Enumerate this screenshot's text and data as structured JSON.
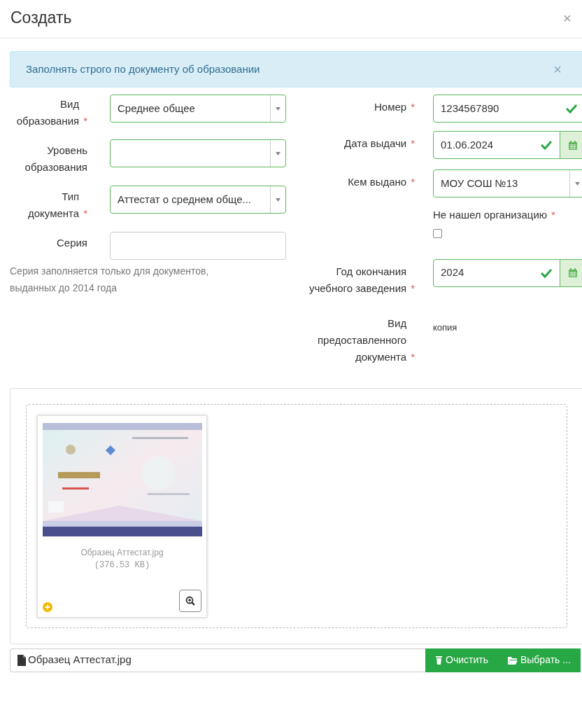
{
  "modal": {
    "title": "Создать",
    "close": "×"
  },
  "alert": {
    "text": "Заполнять строго по документу об образовании",
    "close": "×"
  },
  "left_fields": [
    {
      "kind": "select",
      "label": "Вид образования",
      "required_mark": "*",
      "value": "Среднее общее",
      "valid": true
    },
    {
      "kind": "select",
      "label": "Уровень образования",
      "valid": true
    },
    {
      "kind": "select",
      "label": "Тип документа",
      "required_mark": "*",
      "value": "Аттестат о среднем обще...",
      "valid": true
    },
    {
      "kind": "text",
      "label": "Серия",
      "valid": false
    }
  ],
  "left_note": "Серия заполняется только для документов, выданных до 2014 года",
  "right_fields": [
    {
      "kind": "text",
      "label": "Номер",
      "required_mark": "*",
      "value": "1234567890",
      "valid": true
    },
    {
      "kind": "date",
      "label": "Дата выдачи",
      "required_mark": "*",
      "value": "01.06.2024",
      "valid": true
    },
    {
      "kind": "select",
      "label": "Кем выдано",
      "required_mark": "*",
      "value": "МОУ СОШ №13",
      "valid": true
    },
    {
      "kind": "checkbox",
      "label": "Не нашел организацию",
      "required_mark": "*",
      "checked": false
    },
    {
      "kind": "date",
      "label": "Год окончания учебного заведения",
      "required_mark": "*",
      "value": "2024",
      "valid": true
    },
    {
      "kind": "static",
      "label": "Вид предоставленного документа",
      "required_mark": "*",
      "value": "копия"
    }
  ],
  "upload": {
    "file": {
      "kind": "picture",
      "name": "Образец Аттестат.jpg",
      "size": "(376.53 KB)"
    },
    "caption": "Образец Аттестат.jpg",
    "buttons": [
      "Очистить",
      "Выбрать ..."
    ]
  }
}
